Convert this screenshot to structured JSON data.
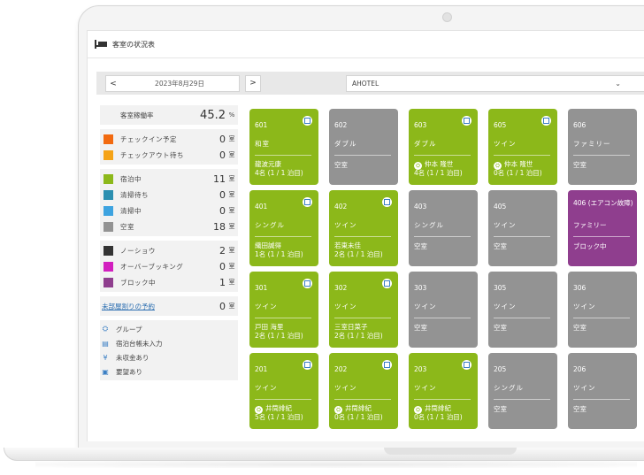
{
  "app": {
    "title": "客室の状況表"
  },
  "toolbar": {
    "prev_label": "<",
    "date": "2023年8月29日",
    "next_label": ">",
    "hotel": "AHOTEL",
    "dropdown_icon": "chevron-down-icon"
  },
  "stats": {
    "occupancy_label": "客室稼働率",
    "occupancy_value": "45.2",
    "occupancy_unit": "%",
    "groups": [
      {
        "items": [
          {
            "label": "チェックイン予定",
            "value": "0",
            "unit": "室",
            "color": "#f26a10"
          },
          {
            "label": "チェックアウト待ち",
            "value": "0",
            "unit": "室",
            "color": "#f5a316"
          }
        ]
      },
      {
        "items": [
          {
            "label": "宿泊中",
            "value": "11",
            "unit": "室",
            "color": "#8cb81a"
          },
          {
            "label": "清掃待ち",
            "value": "0",
            "unit": "室",
            "color": "#2b8fb0"
          },
          {
            "label": "清掃中",
            "value": "0",
            "unit": "室",
            "color": "#3da3e0"
          },
          {
            "label": "空室",
            "value": "18",
            "unit": "室",
            "color": "#939393"
          }
        ]
      },
      {
        "items": [
          {
            "label": "ノーショウ",
            "value": "2",
            "unit": "室",
            "color": "#333333"
          },
          {
            "label": "オーバーブッキング",
            "value": "0",
            "unit": "室",
            "color": "#d21fbf"
          },
          {
            "label": "ブロック中",
            "value": "1",
            "unit": "室",
            "color": "#8f3e8e"
          }
        ]
      }
    ],
    "unassigned_label": "未部屋割りの予約",
    "unassigned_value": "0",
    "unassigned_unit": "室",
    "legend": [
      {
        "icon": "group-icon",
        "glyph": "⛭",
        "label": "グループ"
      },
      {
        "icon": "ledger-icon",
        "glyph": "▤",
        "label": "宿泊台帳未入力"
      },
      {
        "icon": "yen-icon",
        "glyph": "¥",
        "label": "未収金あり"
      },
      {
        "icon": "request-icon",
        "glyph": "▣",
        "label": "要望あり"
      }
    ]
  },
  "rooms": [
    [
      {
        "num": "601",
        "type": "和室",
        "status": "green",
        "badge": true,
        "guest": "龍波元康",
        "stay": "4名 (1 / 1 泊目)"
      },
      {
        "num": "602",
        "type": "ダブル",
        "status": "gray",
        "guest": "空室"
      },
      {
        "num": "603",
        "type": "ダブル",
        "status": "green",
        "badge": true,
        "guest": "仲本 隆世",
        "group": true,
        "stay": "4名 (1 / 1 泊目)"
      },
      {
        "num": "605",
        "type": "ツイン",
        "status": "green",
        "badge": true,
        "guest": "仲本 隆世",
        "group": true,
        "stay": "0名 (1 / 1 泊目)"
      },
      {
        "num": "606",
        "type": "ファミリー",
        "status": "gray",
        "guest": "空室"
      }
    ],
    [
      {
        "num": "401",
        "type": "シングル",
        "status": "green",
        "badge": true,
        "guest": "織田誠得",
        "stay": "1名 (1 / 1 泊目)"
      },
      {
        "num": "402",
        "type": "ツイン",
        "status": "green",
        "badge": true,
        "guest": "若東未佳",
        "stay": "2名 (1 / 1 泊目)"
      },
      {
        "num": "403",
        "type": "シングル",
        "status": "gray",
        "guest": "空室"
      },
      {
        "num": "405",
        "type": "ツイン",
        "status": "gray",
        "guest": "空室"
      },
      {
        "num": "406 (エアコン故障)",
        "type": "ファミリー",
        "status": "purple",
        "guest": "ブロック中"
      }
    ],
    [
      {
        "num": "301",
        "type": "ツイン",
        "status": "green",
        "badge": true,
        "guest": "戸田 海里",
        "stay": "2名 (1 / 1 泊目)"
      },
      {
        "num": "302",
        "type": "ツイン",
        "status": "green",
        "badge": true,
        "guest": "三室日菜子",
        "stay": "2名 (1 / 1 泊目)"
      },
      {
        "num": "303",
        "type": "ツイン",
        "status": "gray",
        "guest": "空室"
      },
      {
        "num": "305",
        "type": "ツイン",
        "status": "gray",
        "guest": "空室"
      },
      {
        "num": "306",
        "type": "ツイン",
        "status": "gray",
        "guest": "空室"
      }
    ],
    [
      {
        "num": "201",
        "type": "ツイン",
        "status": "green",
        "badge": true,
        "guest": "井筒緋紀",
        "group": true,
        "stay": "5名 (1 / 1 泊目)"
      },
      {
        "num": "202",
        "type": "ツイン",
        "status": "green",
        "badge": true,
        "guest": "井筒緋紀",
        "group": true,
        "stay": "0名 (1 / 1 泊目)"
      },
      {
        "num": "203",
        "type": "ツイン",
        "status": "green",
        "badge": true,
        "guest": "井筒緋紀",
        "group": true,
        "stay": "0名 (1 / 1 泊目)"
      },
      {
        "num": "205",
        "type": "シングル",
        "status": "gray",
        "guest": "空室"
      },
      {
        "num": "206",
        "type": "ツイン",
        "status": "gray",
        "guest": "空室"
      }
    ]
  ]
}
